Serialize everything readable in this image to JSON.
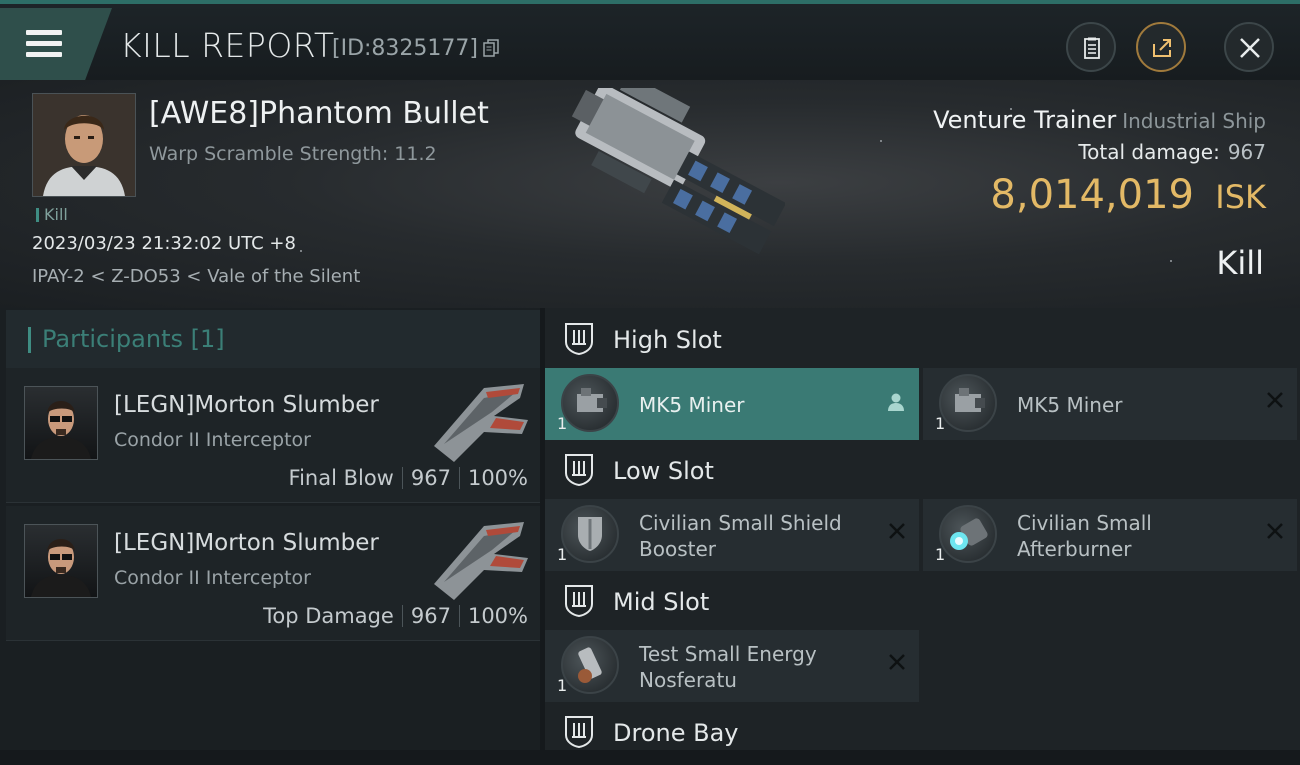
{
  "header": {
    "title": "KILL REPORT",
    "kill_id": "[ID:8325177]"
  },
  "victim": {
    "pilot_name": "[AWE8]Phantom Bullet",
    "warp_scramble": "Warp Scramble Strength: 11.2",
    "tag": "Kill",
    "datetime": "2023/03/23 21:32:02 UTC +8",
    "location": "IPAY-2 < Z-DO53 < Vale of the Silent",
    "ship_name": "Venture Trainer",
    "ship_class": "Industrial Ship",
    "total_damage_label": "Total damage:",
    "total_damage_value": "967",
    "isk_value": "8,014,019",
    "isk_unit": "ISK",
    "kill_type": "Kill"
  },
  "participants": {
    "title": "Participants [1]",
    "rows": [
      {
        "name": "[LEGN]Morton Slumber",
        "ship": "Condor II Interceptor",
        "role": "Final Blow",
        "damage": "967",
        "percent": "100%"
      },
      {
        "name": "[LEGN]Morton Slumber",
        "ship": "Condor II Interceptor",
        "role": "Top Damage",
        "damage": "967",
        "percent": "100%"
      }
    ]
  },
  "fitting": {
    "high_slot": "High Slot",
    "low_slot": "Low Slot",
    "mid_slot": "Mid Slot",
    "drone_bay": "Drone Bay",
    "modules": {
      "high_1": {
        "line1": "MK5 Miner",
        "line2": "",
        "qty": "1"
      },
      "high_2": {
        "line1": "MK5 Miner",
        "line2": "",
        "qty": "1"
      },
      "low_1": {
        "line1": "Civilian Small Shield",
        "line2": "Booster",
        "qty": "1"
      },
      "low_2": {
        "line1": "Civilian Small",
        "line2": "Afterburner",
        "qty": "1"
      },
      "mid_1": {
        "line1": "Test Small Energy",
        "line2": "Nosferatu",
        "qty": "1"
      }
    }
  },
  "colors": {
    "accent": "#3f8d83",
    "isk": "#e3b966",
    "selected_module": "#3a7a74"
  }
}
